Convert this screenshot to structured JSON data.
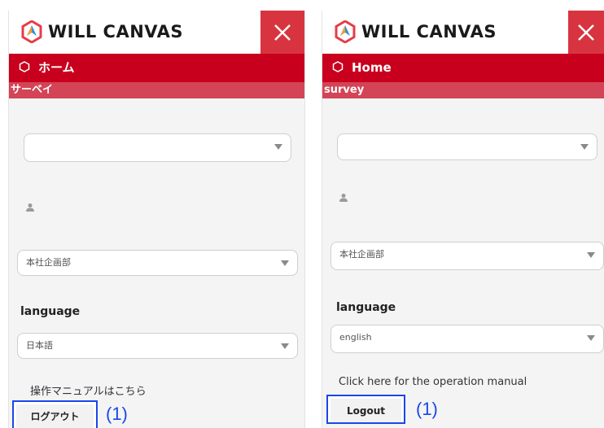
{
  "brand": {
    "name": "WILL CANVAS"
  },
  "panels": {
    "jp": {
      "nav_home": "ホーム",
      "sub_label": "サーベイ",
      "department": "本社企画部",
      "language_label": "language",
      "language_value": "日本語",
      "manual_link": "操作マニュアルはこちら",
      "logout": "ログアウト",
      "annotation": "(1)"
    },
    "en": {
      "nav_home": "Home",
      "sub_label": "survey",
      "department": "本社企画部",
      "language_label": "language",
      "language_value": "english",
      "manual_link": "Click here for the operation manual",
      "logout": "Logout",
      "annotation": "(1)"
    }
  },
  "colors": {
    "nav": "#c8001e",
    "subbar": "#d34456",
    "close": "#d7343f",
    "highlight": "#1a47e8"
  },
  "icons": [
    "will-canvas-logo-icon",
    "close-icon",
    "hexagon-icon",
    "chevron-down-icon",
    "user-icon"
  ]
}
